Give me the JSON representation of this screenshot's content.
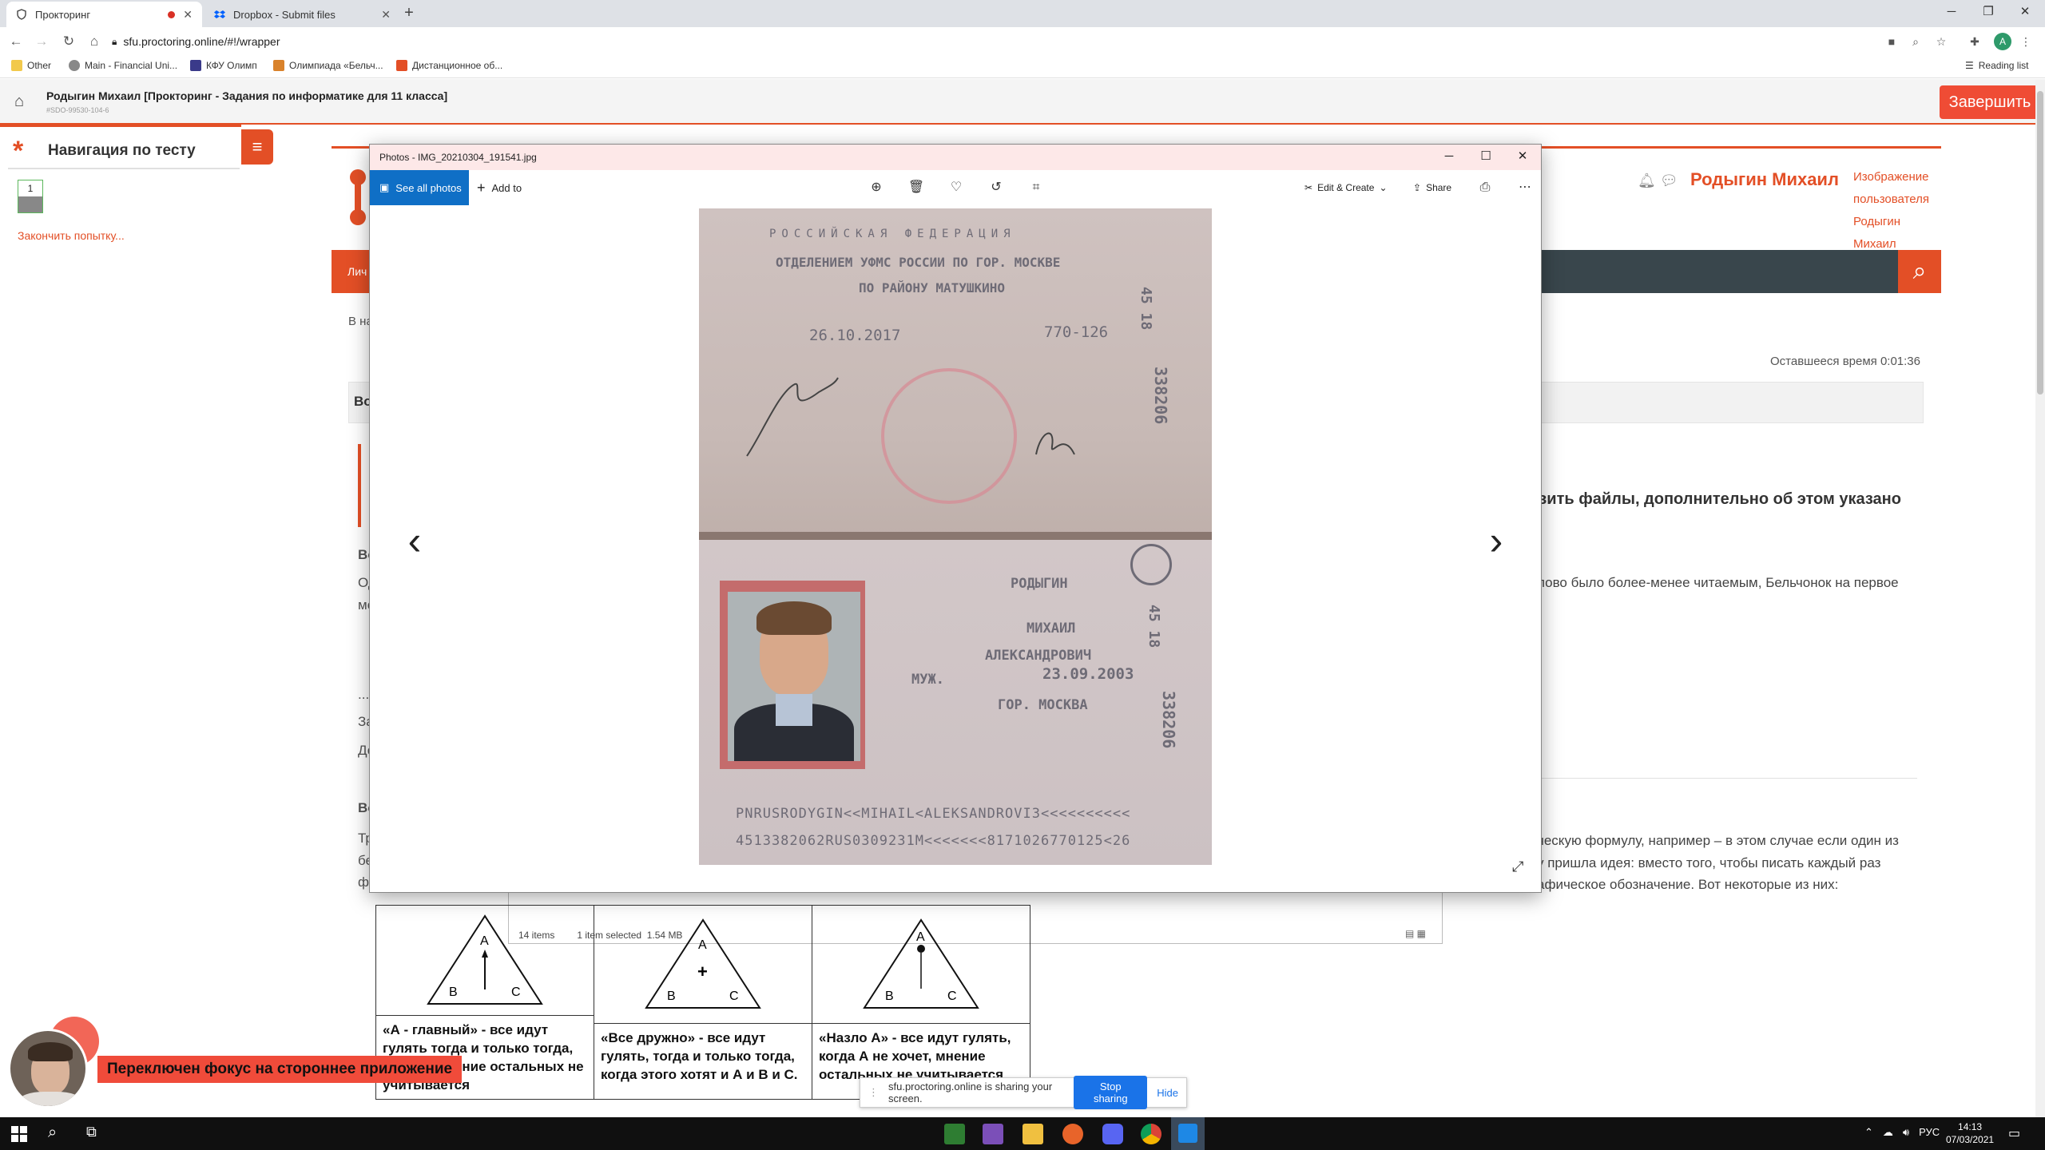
{
  "browser": {
    "tabs": [
      {
        "title": "Прокторинг",
        "recording": true
      },
      {
        "title": "Dropbox - Submit files",
        "recording": false
      }
    ],
    "url": "sfu.proctoring.online/#!/wrapper",
    "bookmarks": [
      "Other",
      "Main - Financial Uni...",
      "КФУ Олимп",
      "Олимпиада «Бельч...",
      "Дистанционное об..."
    ],
    "reading_list": "Reading list",
    "profile_initial": "A"
  },
  "app": {
    "title": "Родыгин Михаил [Прокторинг - Задания по информатике для 11 класса]",
    "session_id": "#SDO-99530-104-6",
    "finish_button": "Завершить"
  },
  "nav": {
    "title": "Навигация по тесту",
    "question_number": "1",
    "finish_attempt": "Закончить попытку..."
  },
  "background_page": {
    "user_name": "Родыгин Михаил",
    "avatar_alt": "Изображение пользователя Родыгин Михаил",
    "menu_fragment": "Лич",
    "breadcrumb_fragment": "В на",
    "time_remaining": "Оставшееся время 0:01:36",
    "grey_fragment": "Во",
    "heading_fragment": "вить файлы, дополнительно об этом указано",
    "text_fragment_1": "лово было более-менее читаемым, Бельчонок на первое",
    "left_fragment_1": "Во",
    "left_fragment_2": "Од",
    "left_fragment_3": "ме",
    "left_fragment_4": "...",
    "left_fragment_5": "За",
    "left_fragment_6": "До",
    "left_fragment_7": "Во",
    "left_fragment_8": "Тр",
    "left_fragment_9": "бе",
    "left_fragment_10": "фо",
    "text_fragment_2": "ческую формулу, например  – в этом случае если один из",
    "text_fragment_3": "у пришла идея: вместо того, чтобы писать каждый раз",
    "text_fragment_4": "афическое обозначение. Вот некоторые из них:",
    "triangles": [
      {
        "top": "A",
        "left": "B",
        "right": "C",
        "symbol": "arrow",
        "caption": "«А - главный» - все идут гулять тогда и только тогда, когда А мнение остальных не учитывается"
      },
      {
        "top": "A",
        "left": "B",
        "right": "C",
        "symbol": "plus",
        "caption": "«Все дружно» - все идут гулять, тогда и только тогда, когда этого хотят и А и B и С."
      },
      {
        "top": "A",
        "left": "B",
        "right": "C",
        "symbol": "dot",
        "caption": "«Назло А» - все идут гулять, когда А не хочет, мнение остальных не учитывается"
      }
    ]
  },
  "explorer": {
    "items": "14 items",
    "selected": "1 item selected",
    "size": "1.54 MB"
  },
  "photos_viewer": {
    "title": "Photos - IMG_20210304_191541.jpg",
    "see_all": "See all photos",
    "add_to": "Add to",
    "edit_create": "Edit & Create",
    "share": "Share"
  },
  "passport": {
    "country": "РОССИЙСКАЯ ФЕДЕРАЦИЯ",
    "issued_by_1": "ОТДЕЛЕНИЕМ УФМС РОССИИ ПО ГОР. МОСКВЕ",
    "issued_by_2": "ПО РАЙОНУ МАТУШКИНО",
    "issue_date": "26.10.2017",
    "division_code": "770-126",
    "series": "45  18",
    "number": "338206",
    "surname": "РОДЫГИН",
    "given_name": "МИХАИЛ",
    "patronymic": "АЛЕКСАНДРОВИЧ",
    "sex": "МУЖ.",
    "birth_date": "23.09.2003",
    "birth_place": "ГОР. МОСКВА",
    "mrz_1": "PNRUSRODYGIN<<MIHAIL<ALEKSANDROVI3<<<<<<<<<<",
    "mrz_2": "4513382062RUS0309231M<<<<<<<8171026770125<26"
  },
  "proctor": {
    "warning": "Переключен фокус на стороннее приложение"
  },
  "sharing": {
    "text": "sfu.proctoring.online is sharing your screen.",
    "stop": "Stop sharing",
    "hide": "Hide"
  },
  "taskbar": {
    "lang": "РУС",
    "time": "14:13",
    "date": "07/03/2021"
  },
  "colors": {
    "accent": "#e34f26",
    "photos_blue": "#0f6fc6",
    "taskbar": "#101010"
  }
}
